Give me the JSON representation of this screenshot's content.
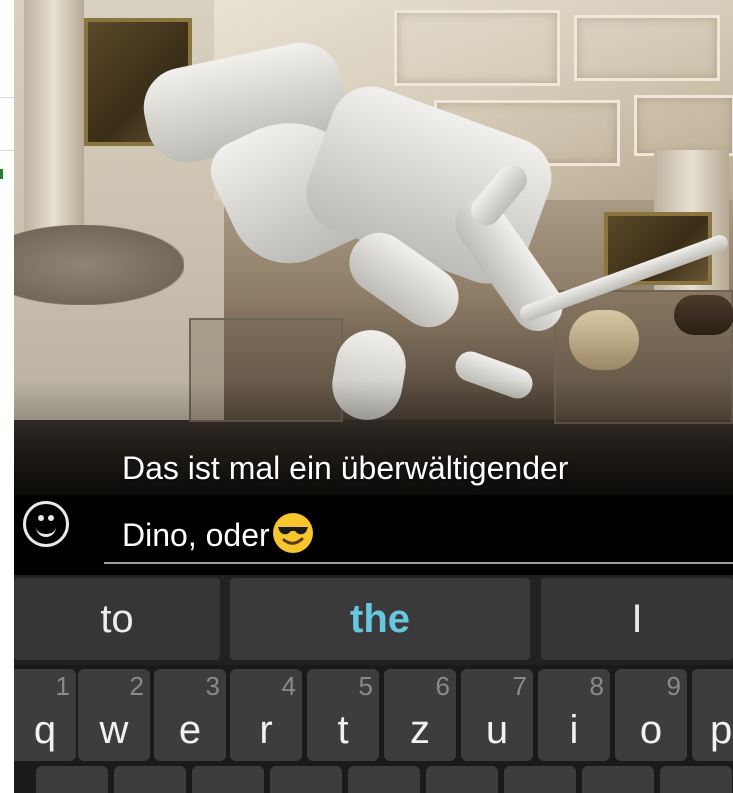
{
  "message": {
    "caption_line": "Das ist mal ein überwältigender",
    "input_text": "Dino,  oder"
  },
  "icons": {
    "emoji_button": "smiley-face-icon",
    "inline_emoji": "sunglasses-emoji"
  },
  "suggestions": [
    "to",
    "the",
    "I"
  ],
  "keyboard": {
    "row1": [
      {
        "letter": "q",
        "hint": "1"
      },
      {
        "letter": "w",
        "hint": "2"
      },
      {
        "letter": "e",
        "hint": "3"
      },
      {
        "letter": "r",
        "hint": "4"
      },
      {
        "letter": "t",
        "hint": "5"
      },
      {
        "letter": "z",
        "hint": "6"
      },
      {
        "letter": "u",
        "hint": "7"
      },
      {
        "letter": "i",
        "hint": "8"
      },
      {
        "letter": "o",
        "hint": "9"
      },
      {
        "letter": "p",
        "hint": ""
      }
    ]
  },
  "colors": {
    "suggestion_highlight": "#67c7df",
    "keyboard_bg": "#1a1a1a",
    "key_bg": "#3d3d3d"
  }
}
